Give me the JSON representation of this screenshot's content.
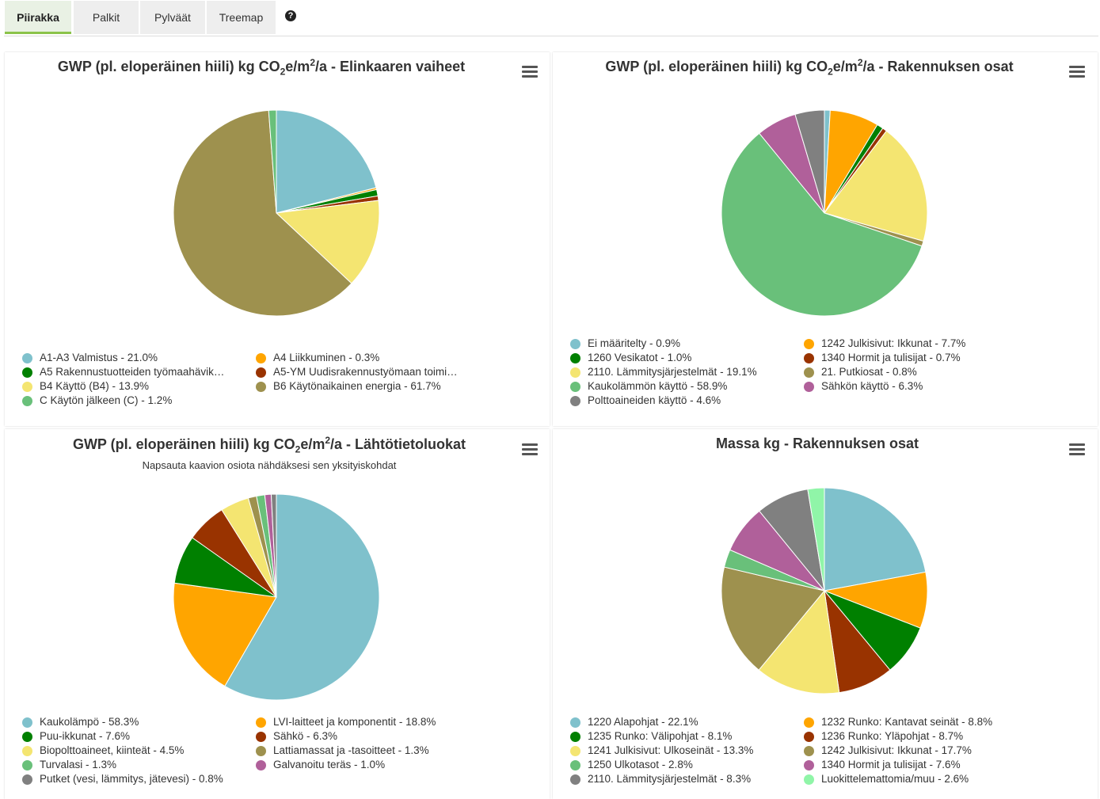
{
  "tabs": [
    {
      "label": "Piirakka",
      "active": true
    },
    {
      "label": "Palkit",
      "active": false
    },
    {
      "label": "Pylväät",
      "active": false
    },
    {
      "label": "Treemap",
      "active": false
    }
  ],
  "help_icon": "?",
  "colors": {
    "tab_active_accent": "#8bc34a"
  },
  "chart_data": [
    {
      "type": "pie",
      "title": "GWP (pl. eloperäinen hiili) kg CO₂e/m²/a - Elinkaaren vaiheet",
      "title_parts": {
        "a": "GWP (pl. eloperäinen hiili) kg CO",
        "b": "2",
        "c": "e/m",
        "d": "2",
        "e": "/a - Elinkaaren vaiheet"
      },
      "subtitle": "",
      "categories": [
        "A1-A3 Valmistus",
        "A4 Liikkuminen",
        "A5 Rakennustuotteiden työmaahävik…",
        "A5-YM Uudisrakennustyömaan toimi…",
        "B4 Käyttö (B4)",
        "B6 Käytönaikainen energia",
        "C Käytön jälkeen (C)"
      ],
      "values": [
        21.0,
        0.3,
        1.0,
        0.7,
        13.9,
        61.7,
        1.2
      ],
      "colors": [
        "#7fc1cc",
        "#ffa500",
        "#008000",
        "#993300",
        "#f4e571",
        "#9e914e",
        "#69c07a"
      ],
      "legend_labels": [
        "A1-A3 Valmistus - 21.0%",
        "A4 Liikkuminen - 0.3%",
        "A5 Rakennustuotteiden työmaahävik…",
        "A5-YM Uudisrakennustyömaan toimi…",
        "B4 Käyttö (B4) - 13.9%",
        "B6 Käytönaikainen energia - 61.7%",
        "C Käytön jälkeen (C) - 1.2%"
      ]
    },
    {
      "type": "pie",
      "title": "GWP (pl. eloperäinen hiili) kg CO₂e/m²/a - Rakennuksen osat",
      "title_parts": {
        "a": "GWP (pl. eloperäinen hiili) kg CO",
        "b": "2",
        "c": "e/m",
        "d": "2",
        "e": "/a - Rakennuksen osat"
      },
      "subtitle": "",
      "categories": [
        "Ei määritelty",
        "1242 Julkisivut: Ikkunat",
        "1260 Vesikatot",
        "1340 Hormit ja tulisijat",
        "2110. Lämmitysjärjestelmät",
        "21. Putkiosat",
        "Kaukolämmön käyttö",
        "Sähkön käyttö",
        "Polttoaineiden käyttö"
      ],
      "values": [
        0.9,
        7.7,
        1.0,
        0.7,
        19.1,
        0.8,
        58.9,
        6.3,
        4.6
      ],
      "colors": [
        "#7fc1cc",
        "#ffa500",
        "#008000",
        "#993300",
        "#f4e571",
        "#9e914e",
        "#69c07a",
        "#b0609a",
        "#808080"
      ],
      "legend_labels": [
        "Ei määritelty - 0.9%",
        "1242 Julkisivut: Ikkunat - 7.7%",
        "1260 Vesikatot - 1.0%",
        "1340 Hormit ja tulisijat - 0.7%",
        "2110. Lämmitysjärjestelmät - 19.1%",
        "21. Putkiosat - 0.8%",
        "Kaukolämmön käyttö - 58.9%",
        "Sähkön käyttö - 6.3%",
        "Polttoaineiden käyttö - 4.6%"
      ]
    },
    {
      "type": "pie",
      "title": "GWP (pl. eloperäinen hiili) kg CO₂e/m²/a - Lähtötietoluokat",
      "title_parts": {
        "a": "GWP (pl. eloperäinen hiili) kg CO",
        "b": "2",
        "c": "e/m",
        "d": "2",
        "e": "/a - Lähtötietoluokat"
      },
      "subtitle": "Napsauta kaavion osiota nähdäksesi sen yksityiskohdat",
      "categories": [
        "Kaukolämpö",
        "LVI-laitteet ja komponentit",
        "Puu-ikkunat",
        "Sähkö",
        "Biopolttoaineet, kiinteät",
        "Lattiamassat ja -tasoitteet",
        "Turvalasi",
        "Galvanoitu teräs",
        "Putket (vesi, lämmitys, jätevesi)"
      ],
      "values": [
        58.3,
        18.8,
        7.6,
        6.3,
        4.5,
        1.3,
        1.3,
        1.0,
        0.8
      ],
      "colors": [
        "#7fc1cc",
        "#ffa500",
        "#008000",
        "#993300",
        "#f4e571",
        "#9e914e",
        "#69c07a",
        "#b0609a",
        "#808080"
      ],
      "legend_labels": [
        "Kaukolämpö - 58.3%",
        "LVI-laitteet ja komponentit - 18.8%",
        "Puu-ikkunat - 7.6%",
        "Sähkö - 6.3%",
        "Biopolttoaineet, kiinteät - 4.5%",
        "Lattiamassat ja -tasoitteet - 1.3%",
        "Turvalasi - 1.3%",
        "Galvanoitu teräs - 1.0%",
        "Putket (vesi, lämmitys, jätevesi) - 0.8%"
      ]
    },
    {
      "type": "pie",
      "title": "Massa kg - Rakennuksen osat",
      "subtitle": "",
      "categories": [
        "1220 Alapohjat",
        "1232 Runko: Kantavat seinät",
        "1235 Runko: Välipohjat",
        "1236 Runko: Yläpohjat",
        "1241 Julkisivut: Ulkoseinät",
        "1242 Julkisivut: Ikkunat",
        "1250 Ulkotasot",
        "1340 Hormit ja tulisijat",
        "2110. Lämmitysjärjestelmät",
        "Luokittelemattomia/muu"
      ],
      "values": [
        22.1,
        8.8,
        8.1,
        8.7,
        13.3,
        17.7,
        2.8,
        7.6,
        8.3,
        2.6
      ],
      "colors": [
        "#7fc1cc",
        "#ffa500",
        "#008000",
        "#993300",
        "#f4e571",
        "#9e914e",
        "#69c07a",
        "#b0609a",
        "#808080",
        "#90f5a8"
      ],
      "legend_labels": [
        "1220 Alapohjat - 22.1%",
        "1232 Runko: Kantavat seinät - 8.8%",
        "1235 Runko: Välipohjat - 8.1%",
        "1236 Runko: Yläpohjat - 8.7%",
        "1241 Julkisivut: Ulkoseinät - 13.3%",
        "1242 Julkisivut: Ikkunat - 17.7%",
        "1250 Ulkotasot - 2.8%",
        "1340 Hormit ja tulisijat - 7.6%",
        "2110. Lämmitysjärjestelmät - 8.3%",
        "Luokittelemattomia/muu - 2.6%"
      ]
    }
  ]
}
